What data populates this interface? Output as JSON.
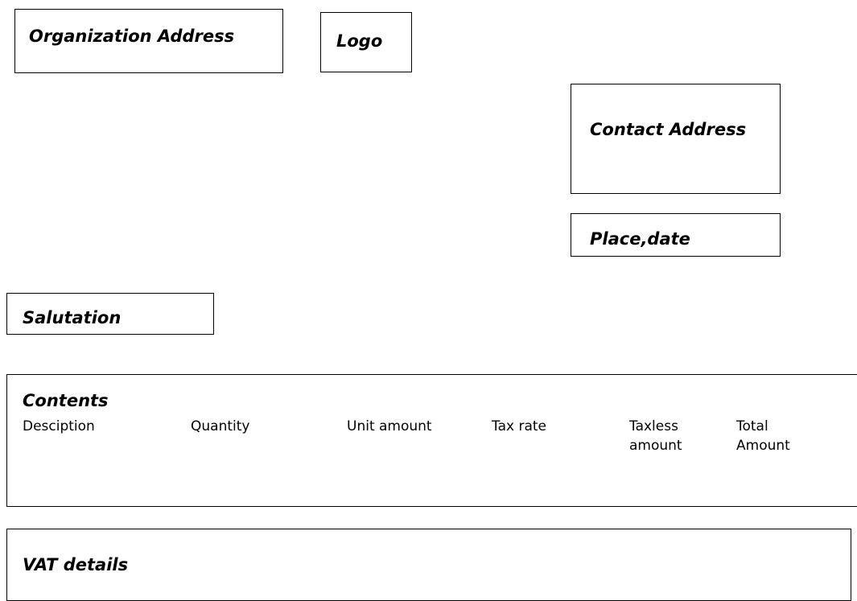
{
  "organization_address": {
    "title": "Organization Address"
  },
  "logo": {
    "title": "Logo"
  },
  "contact_address": {
    "title": "Contact Address"
  },
  "place_date": {
    "title": "Place,date"
  },
  "salutation": {
    "title": "Salutation"
  },
  "contents": {
    "title": "Contents",
    "columns": [
      {
        "label_line1": "Desciption",
        "label_line2": ""
      },
      {
        "label_line1": "Quantity",
        "label_line2": ""
      },
      {
        "label_line1": "Unit amount",
        "label_line2": ""
      },
      {
        "label_line1": "Tax rate",
        "label_line2": ""
      },
      {
        "label_line1": "Taxless",
        "label_line2": "amount"
      },
      {
        "label_line1": "Total",
        "label_line2": "Amount"
      }
    ]
  },
  "vat_details": {
    "title": "VAT details"
  }
}
